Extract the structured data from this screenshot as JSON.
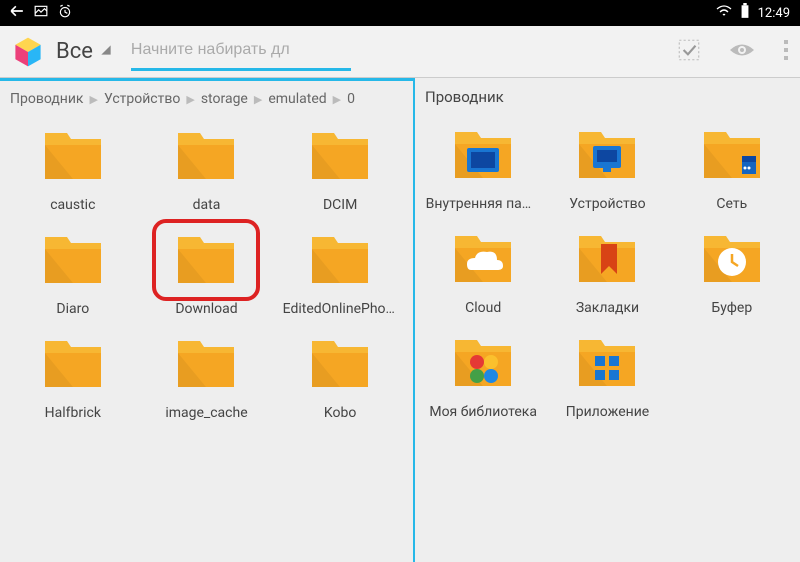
{
  "statusbar": {
    "time": "12:49"
  },
  "header": {
    "spinner_label": "Все",
    "search_placeholder": "Начните набирать дл"
  },
  "left": {
    "breadcrumb": [
      "Проводник",
      "Устройство",
      "storage",
      "emulated",
      "0"
    ],
    "items": [
      {
        "name": "caustic",
        "type": "folder"
      },
      {
        "name": "data",
        "type": "folder"
      },
      {
        "name": "DCIM",
        "type": "folder"
      },
      {
        "name": "Diaro",
        "type": "folder"
      },
      {
        "name": "Download",
        "type": "folder",
        "highlighted": true
      },
      {
        "name": "EditedOnlinePhotos",
        "type": "folder"
      },
      {
        "name": "Halfbrick",
        "type": "folder"
      },
      {
        "name": "image_cache",
        "type": "folder"
      },
      {
        "name": "Kobo",
        "type": "folder"
      }
    ]
  },
  "right": {
    "title": "Проводник",
    "items": [
      {
        "name": "Внутренняя память",
        "overlay": "sd"
      },
      {
        "name": "Устройство",
        "overlay": "device"
      },
      {
        "name": "Сеть",
        "overlay": "net"
      },
      {
        "name": "Cloud",
        "overlay": "cloud"
      },
      {
        "name": "Закладки",
        "overlay": "bookmark"
      },
      {
        "name": "Буфер",
        "overlay": "clock"
      },
      {
        "name": "Моя библиотека",
        "overlay": "dots"
      },
      {
        "name": "Приложение",
        "overlay": "tiles"
      }
    ]
  }
}
